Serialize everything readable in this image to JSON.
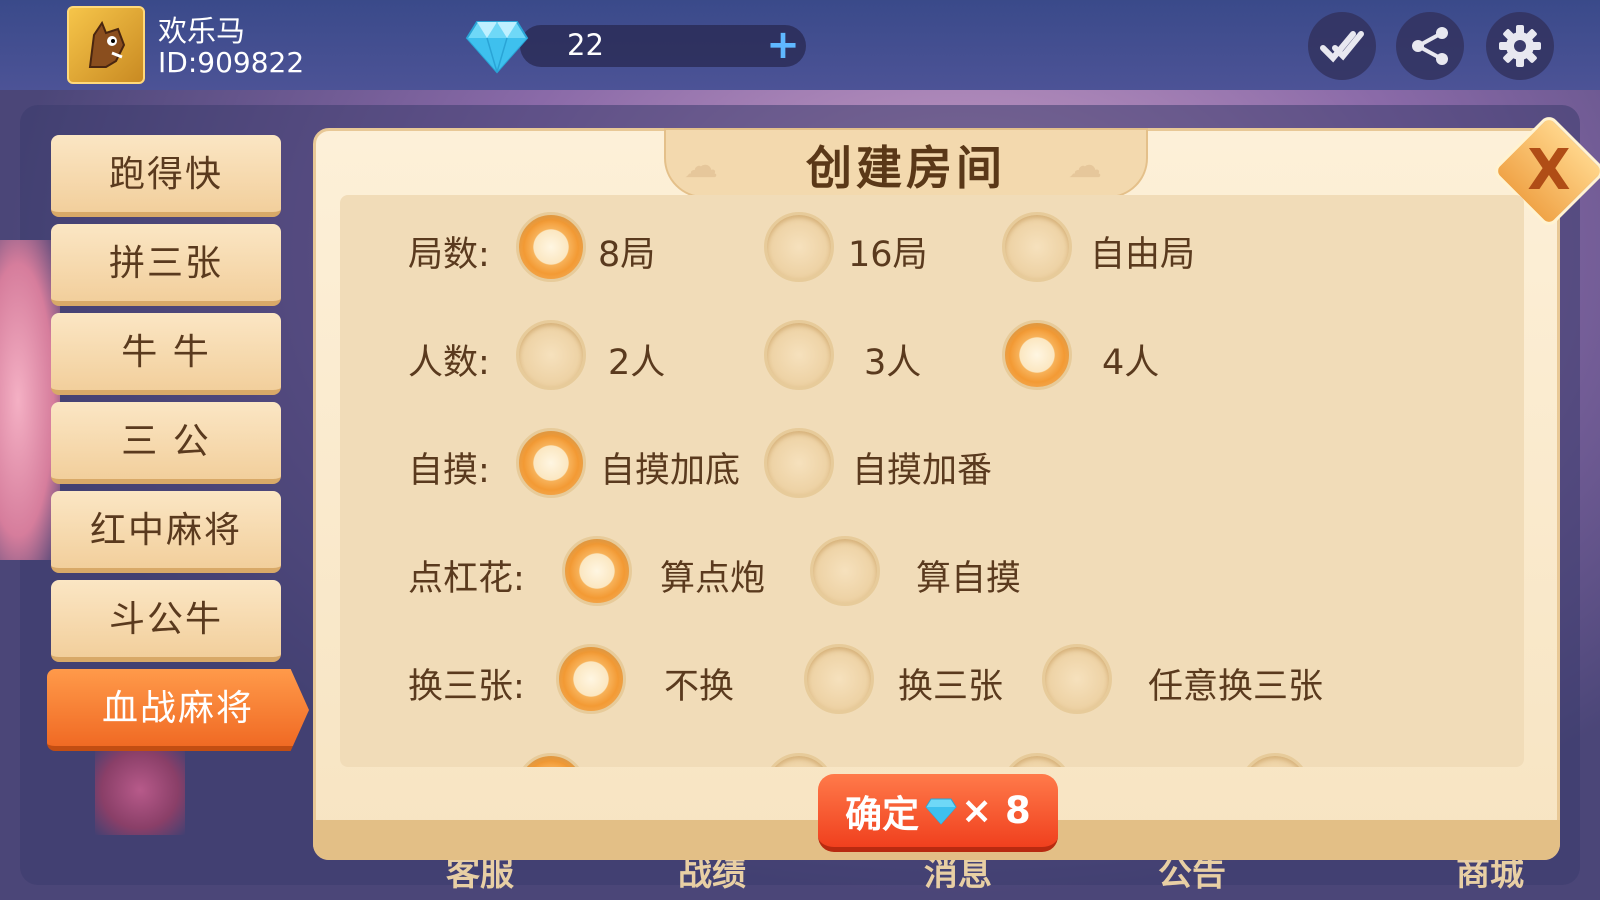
{
  "user": {
    "name": "欢乐马",
    "id": "ID:909822"
  },
  "currency": {
    "gems": "22",
    "plus": "+"
  },
  "menu": [
    {
      "label": "跑得快"
    },
    {
      "label": "拼三张"
    },
    {
      "label": "牛 牛"
    },
    {
      "label": "三 公"
    },
    {
      "label": "红中麻将"
    },
    {
      "label": "斗公牛"
    },
    {
      "label": "血战麻将",
      "active": true
    }
  ],
  "dialog": {
    "title": "创建房间",
    "close": "X",
    "rows": [
      {
        "label": "局数:",
        "options": [
          "8局",
          "16局",
          "自由局"
        ],
        "selected": 0
      },
      {
        "label": "人数:",
        "options": [
          "2人",
          "3人",
          "4人"
        ],
        "selected": 2
      },
      {
        "label": "自摸:",
        "options": [
          "自摸加底",
          "自摸加番"
        ],
        "selected": 0
      },
      {
        "label": "点杠花:",
        "options": [
          "算点炮",
          "算自摸"
        ],
        "selected": 0
      },
      {
        "label": "换三张:",
        "options": [
          "不换",
          "换三张",
          "任意换三张"
        ],
        "selected": 0
      }
    ],
    "confirm": {
      "label": "确定",
      "cost": "× 8"
    }
  },
  "bottom_nav": [
    "客服",
    "战绩",
    "消息",
    "公告",
    "商城"
  ],
  "colors": {
    "accent": "#f06a24",
    "panel": "#f1dcb8",
    "text": "#5a3a1e"
  }
}
